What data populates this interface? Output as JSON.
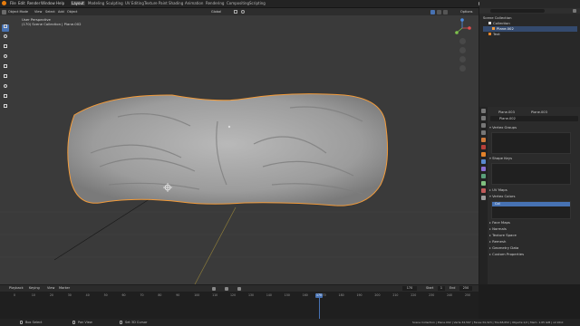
{
  "menus": [
    "File",
    "Edit",
    "Render",
    "Window",
    "Help"
  ],
  "workspaces": [
    {
      "label": "Layout",
      "active": true
    },
    {
      "label": "Modeling",
      "active": false
    },
    {
      "label": "Sculpting",
      "active": false
    },
    {
      "label": "UV Editing",
      "active": false
    },
    {
      "label": "Texture Paint",
      "active": false
    },
    {
      "label": "Shading",
      "active": false
    },
    {
      "label": "Animation",
      "active": false
    },
    {
      "label": "Rendering",
      "active": false
    },
    {
      "label": "Compositing",
      "active": false
    },
    {
      "label": "Scripting",
      "active": false
    }
  ],
  "scene_name": "Scene",
  "view_layer": "View Layer",
  "viewport": {
    "mode": "Object Mode",
    "menus": [
      "View",
      "Select",
      "Add",
      "Object"
    ],
    "transform": "Global",
    "view_name": "User Perspective",
    "collection_path": "(170) Scene Collection | Plane.002",
    "options": "Options"
  },
  "tools": [
    "select",
    "cursor",
    "move",
    "rotate",
    "scale",
    "transform",
    "annotate",
    "measure",
    "add-cube"
  ],
  "outliner": {
    "rows": [
      {
        "label": "Scene Collection",
        "indent": 0,
        "selected": false
      },
      {
        "label": "Collection",
        "indent": 1,
        "selected": false
      },
      {
        "label": "Plane.002",
        "indent": 1,
        "selected": true
      },
      {
        "label": "Text",
        "indent": 1,
        "selected": false
      }
    ]
  },
  "properties": {
    "object_tabs": [
      "Plane.003",
      "Plane.003"
    ],
    "mesh_name": "Plane.002",
    "sections": [
      {
        "label": "Vertex Groups",
        "open": true
      },
      {
        "label": "Shape Keys",
        "open": true
      },
      {
        "label": "UV Maps",
        "open": false
      },
      {
        "label": "Vertex Colors",
        "open": true
      },
      {
        "label": "Face Maps",
        "open": false
      },
      {
        "label": "Normals",
        "open": false
      },
      {
        "label": "Texture Space",
        "open": false
      },
      {
        "label": "Remesh",
        "open": false
      },
      {
        "label": "Geometry Data",
        "open": false
      },
      {
        "label": "Custom Properties",
        "open": false
      }
    ],
    "vertex_color_item": "Col"
  },
  "timeline": {
    "menus": [
      "Playback",
      "Keying",
      "View",
      "Marker"
    ],
    "current_frame": "170",
    "start_label": "Start",
    "start": "1",
    "end_label": "End",
    "end": "250",
    "ticks": [
      "0",
      "10",
      "20",
      "30",
      "40",
      "50",
      "60",
      "70",
      "80",
      "90",
      "100",
      "110",
      "120",
      "130",
      "140",
      "150",
      "160",
      "170",
      "180",
      "190",
      "200",
      "210",
      "220",
      "230",
      "240",
      "250"
    ]
  },
  "status": {
    "select": "Box Select",
    "pan": "Pan View",
    "context": "Set 3D Cursor",
    "stats": "Scene Collection | Plane.002 | Verts:34,597 | Faces:34,323 | Tris:68,652 | Objects:1/2 | Mem: 1.65 GiB | v2.90.0"
  },
  "colors": {
    "accent": "#4772b3",
    "selection": "#f29b3a",
    "active_tab": "#3d3d3d"
  }
}
